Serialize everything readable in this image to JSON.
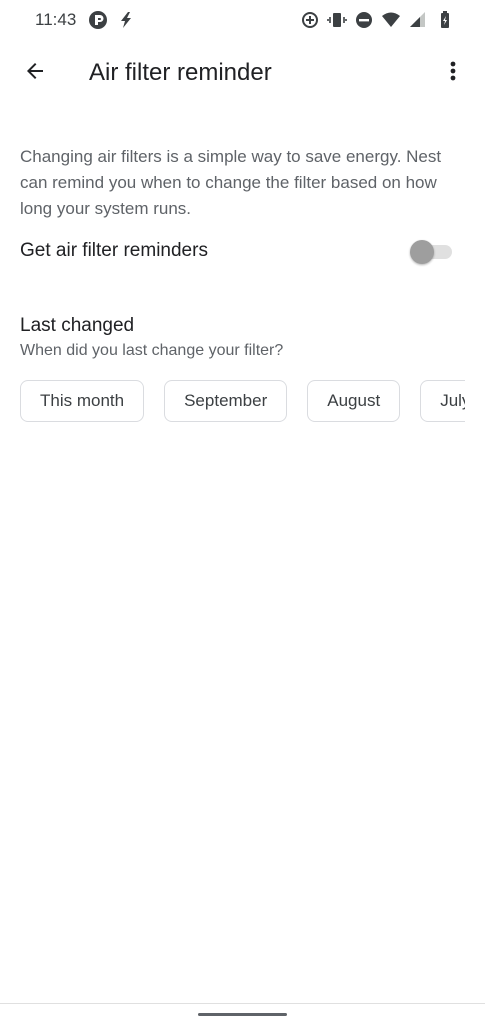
{
  "status_bar": {
    "time": "11:43",
    "left_icons": [
      "app-notification-icon",
      "flash-icon"
    ],
    "right_icons": [
      "data-saver-icon",
      "vibrate-icon",
      "do-not-disturb-icon",
      "wifi-icon",
      "signal-icon",
      "battery-charging-icon"
    ]
  },
  "app_bar": {
    "back_icon": "arrow-back-icon",
    "title": "Air filter reminder",
    "menu_icon": "more-vert-icon"
  },
  "main": {
    "description": "Changing air filters is a simple way to save energy. Nest can remind you when to change the filter based on how long your system runs.",
    "toggle_label": "Get air filter reminders",
    "toggle_on": false,
    "last_changed_title": "Last changed",
    "last_changed_subtitle": "When did you last change your filter?",
    "chips": [
      {
        "label": "This month"
      },
      {
        "label": "September"
      },
      {
        "label": "August"
      },
      {
        "label": "July"
      }
    ]
  },
  "colors": {
    "text_primary": "#202124",
    "text_secondary": "#5f6368",
    "chip_border": "#dadce0",
    "toggle_thumb_off": "#9e9e9e",
    "toggle_track_off": "#e0e0e0"
  }
}
